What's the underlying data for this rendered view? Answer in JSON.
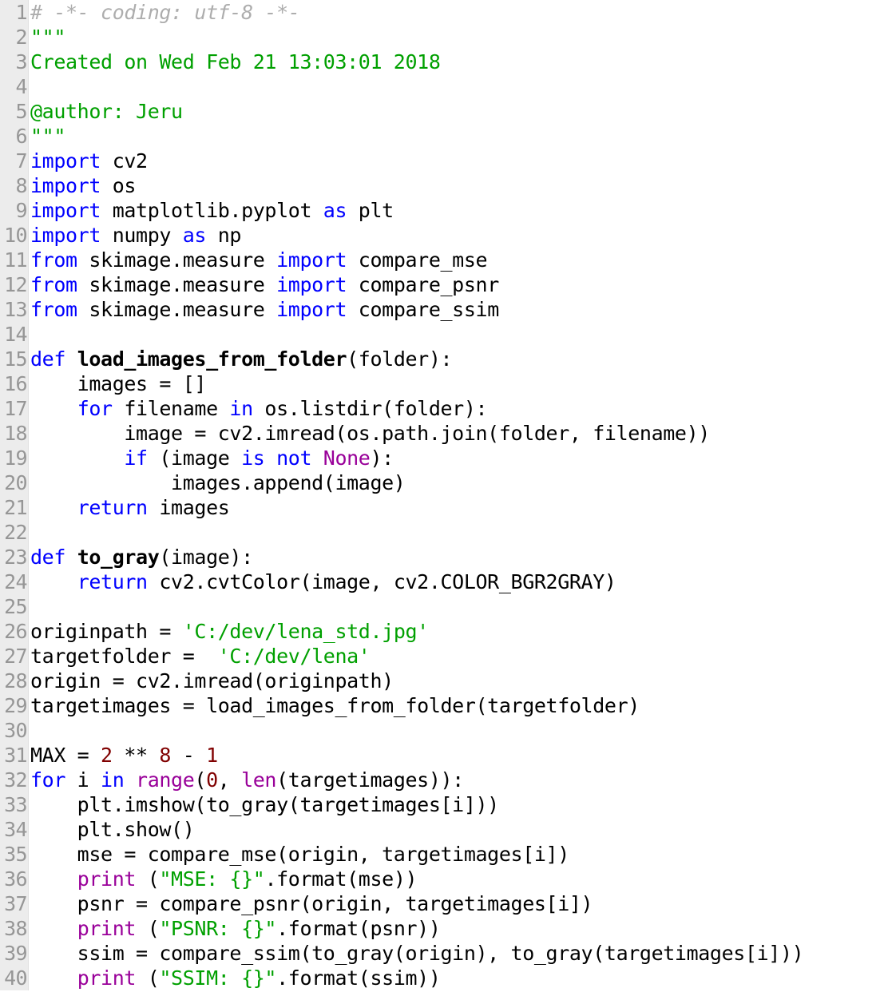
{
  "editor": {
    "language": "python",
    "gutter_bg": "#ececec",
    "code_bg": "#ffffff",
    "line_number_color": "#969696",
    "first_line": 1,
    "last_line": 40,
    "total_visible_lines": 40,
    "palette": {
      "plain": "#000000",
      "comment": "#adadad",
      "string": "#00a000",
      "docstring": "#00a000",
      "keyword": "#0000ff",
      "builtin": "#990099",
      "constant": "#990099",
      "number": "#800000",
      "definition": "#000000"
    }
  },
  "lines": [
    {
      "num": "1",
      "tokens": [
        {
          "t": "# -*- coding: utf-8 -*-",
          "c": "comment"
        }
      ]
    },
    {
      "num": "2",
      "tokens": [
        {
          "t": "\"\"\"",
          "c": "doc"
        }
      ]
    },
    {
      "num": "3",
      "tokens": [
        {
          "t": "Created on Wed Feb 21 13:03:01 2018",
          "c": "doc"
        }
      ]
    },
    {
      "num": "4",
      "tokens": [
        {
          "t": "",
          "c": "doc"
        }
      ]
    },
    {
      "num": "5",
      "tokens": [
        {
          "t": "@author: Jeru",
          "c": "doc"
        }
      ]
    },
    {
      "num": "6",
      "tokens": [
        {
          "t": "\"\"\"",
          "c": "doc"
        }
      ]
    },
    {
      "num": "7",
      "tokens": [
        {
          "t": "import",
          "c": "kw"
        },
        {
          "t": " cv2",
          "c": "plain"
        }
      ]
    },
    {
      "num": "8",
      "tokens": [
        {
          "t": "import",
          "c": "kw"
        },
        {
          "t": " os",
          "c": "plain"
        }
      ]
    },
    {
      "num": "9",
      "tokens": [
        {
          "t": "import",
          "c": "kw"
        },
        {
          "t": " matplotlib.pyplot ",
          "c": "plain"
        },
        {
          "t": "as",
          "c": "kw"
        },
        {
          "t": " plt",
          "c": "plain"
        }
      ]
    },
    {
      "num": "10",
      "tokens": [
        {
          "t": "import",
          "c": "kw"
        },
        {
          "t": " numpy ",
          "c": "plain"
        },
        {
          "t": "as",
          "c": "kw"
        },
        {
          "t": " np",
          "c": "plain"
        }
      ]
    },
    {
      "num": "11",
      "tokens": [
        {
          "t": "from",
          "c": "kw"
        },
        {
          "t": " skimage.measure ",
          "c": "plain"
        },
        {
          "t": "import",
          "c": "kw"
        },
        {
          "t": " compare_mse",
          "c": "plain"
        }
      ]
    },
    {
      "num": "12",
      "tokens": [
        {
          "t": "from",
          "c": "kw"
        },
        {
          "t": " skimage.measure ",
          "c": "plain"
        },
        {
          "t": "import",
          "c": "kw"
        },
        {
          "t": " compare_psnr",
          "c": "plain"
        }
      ]
    },
    {
      "num": "13",
      "tokens": [
        {
          "t": "from",
          "c": "kw"
        },
        {
          "t": " skimage.measure ",
          "c": "plain"
        },
        {
          "t": "import",
          "c": "kw"
        },
        {
          "t": " compare_ssim",
          "c": "plain"
        }
      ]
    },
    {
      "num": "14",
      "tokens": [
        {
          "t": "",
          "c": "plain"
        }
      ]
    },
    {
      "num": "15",
      "tokens": [
        {
          "t": "def",
          "c": "kw"
        },
        {
          "t": " ",
          "c": "plain"
        },
        {
          "t": "load_images_from_folder",
          "c": "defname"
        },
        {
          "t": "(folder):",
          "c": "plain"
        }
      ]
    },
    {
      "num": "16",
      "tokens": [
        {
          "t": "    images = []",
          "c": "plain"
        }
      ]
    },
    {
      "num": "17",
      "tokens": [
        {
          "t": "    ",
          "c": "plain"
        },
        {
          "t": "for",
          "c": "kw"
        },
        {
          "t": " filename ",
          "c": "plain"
        },
        {
          "t": "in",
          "c": "kw"
        },
        {
          "t": " os.listdir(folder):",
          "c": "plain"
        }
      ]
    },
    {
      "num": "18",
      "tokens": [
        {
          "t": "        image = cv2.imread(os.path.join(folder, filename))",
          "c": "plain"
        }
      ]
    },
    {
      "num": "19",
      "tokens": [
        {
          "t": "        ",
          "c": "plain"
        },
        {
          "t": "if",
          "c": "kw"
        },
        {
          "t": " (image ",
          "c": "plain"
        },
        {
          "t": "is",
          "c": "kw"
        },
        {
          "t": " ",
          "c": "plain"
        },
        {
          "t": "not",
          "c": "kw"
        },
        {
          "t": " ",
          "c": "plain"
        },
        {
          "t": "None",
          "c": "const"
        },
        {
          "t": "):",
          "c": "plain"
        }
      ]
    },
    {
      "num": "20",
      "tokens": [
        {
          "t": "            images.append(image)",
          "c": "plain"
        }
      ]
    },
    {
      "num": "21",
      "tokens": [
        {
          "t": "    ",
          "c": "plain"
        },
        {
          "t": "return",
          "c": "kw"
        },
        {
          "t": " images",
          "c": "plain"
        }
      ]
    },
    {
      "num": "22",
      "tokens": [
        {
          "t": "",
          "c": "plain"
        }
      ]
    },
    {
      "num": "23",
      "tokens": [
        {
          "t": "def",
          "c": "kw"
        },
        {
          "t": " ",
          "c": "plain"
        },
        {
          "t": "to_gray",
          "c": "defname"
        },
        {
          "t": "(image):",
          "c": "plain"
        }
      ]
    },
    {
      "num": "24",
      "tokens": [
        {
          "t": "    ",
          "c": "plain"
        },
        {
          "t": "return",
          "c": "kw"
        },
        {
          "t": " cv2.cvtColor(image, cv2.COLOR_BGR2GRAY)",
          "c": "plain"
        }
      ]
    },
    {
      "num": "25",
      "tokens": [
        {
          "t": "",
          "c": "plain"
        }
      ]
    },
    {
      "num": "26",
      "tokens": [
        {
          "t": "originpath = ",
          "c": "plain"
        },
        {
          "t": "'C:/dev/lena_std.jpg'",
          "c": "string"
        }
      ]
    },
    {
      "num": "27",
      "tokens": [
        {
          "t": "targetfolder =  ",
          "c": "plain"
        },
        {
          "t": "'C:/dev/lena'",
          "c": "string"
        }
      ]
    },
    {
      "num": "28",
      "tokens": [
        {
          "t": "origin = cv2.imread(originpath)",
          "c": "plain"
        }
      ]
    },
    {
      "num": "29",
      "tokens": [
        {
          "t": "targetimages = load_images_from_folder(targetfolder)",
          "c": "plain"
        }
      ]
    },
    {
      "num": "30",
      "tokens": [
        {
          "t": "",
          "c": "plain"
        }
      ]
    },
    {
      "num": "31",
      "tokens": [
        {
          "t": "MAX = ",
          "c": "plain"
        },
        {
          "t": "2",
          "c": "number"
        },
        {
          "t": " ** ",
          "c": "plain"
        },
        {
          "t": "8",
          "c": "number"
        },
        {
          "t": " - ",
          "c": "plain"
        },
        {
          "t": "1",
          "c": "number"
        }
      ]
    },
    {
      "num": "32",
      "tokens": [
        {
          "t": "for",
          "c": "kw"
        },
        {
          "t": " i ",
          "c": "plain"
        },
        {
          "t": "in",
          "c": "kw"
        },
        {
          "t": " ",
          "c": "plain"
        },
        {
          "t": "range",
          "c": "builtin"
        },
        {
          "t": "(",
          "c": "plain"
        },
        {
          "t": "0",
          "c": "number"
        },
        {
          "t": ", ",
          "c": "plain"
        },
        {
          "t": "len",
          "c": "builtin"
        },
        {
          "t": "(targetimages)):",
          "c": "plain"
        }
      ]
    },
    {
      "num": "33",
      "tokens": [
        {
          "t": "    plt.imshow(to_gray(targetimages[i]))",
          "c": "plain"
        }
      ]
    },
    {
      "num": "34",
      "tokens": [
        {
          "t": "    plt.show()",
          "c": "plain"
        }
      ]
    },
    {
      "num": "35",
      "tokens": [
        {
          "t": "    mse = compare_mse(origin, targetimages[i])",
          "c": "plain"
        }
      ]
    },
    {
      "num": "36",
      "tokens": [
        {
          "t": "    ",
          "c": "plain"
        },
        {
          "t": "print",
          "c": "builtin"
        },
        {
          "t": " (",
          "c": "plain"
        },
        {
          "t": "\"MSE: {}\"",
          "c": "string"
        },
        {
          "t": ".format(mse))",
          "c": "plain"
        }
      ]
    },
    {
      "num": "37",
      "tokens": [
        {
          "t": "    psnr = compare_psnr(origin, targetimages[i])",
          "c": "plain"
        }
      ]
    },
    {
      "num": "38",
      "tokens": [
        {
          "t": "    ",
          "c": "plain"
        },
        {
          "t": "print",
          "c": "builtin"
        },
        {
          "t": " (",
          "c": "plain"
        },
        {
          "t": "\"PSNR: {}\"",
          "c": "string"
        },
        {
          "t": ".format(psnr))",
          "c": "plain"
        }
      ]
    },
    {
      "num": "39",
      "tokens": [
        {
          "t": "    ssim = compare_ssim(to_gray(origin), to_gray(targetimages[i]))",
          "c": "plain"
        }
      ]
    },
    {
      "num": "40",
      "tokens": [
        {
          "t": "    ",
          "c": "plain"
        },
        {
          "t": "print",
          "c": "builtin"
        },
        {
          "t": " (",
          "c": "plain"
        },
        {
          "t": "\"SSIM: {}\"",
          "c": "string"
        },
        {
          "t": ".format(ssim))",
          "c": "plain"
        }
      ]
    }
  ]
}
